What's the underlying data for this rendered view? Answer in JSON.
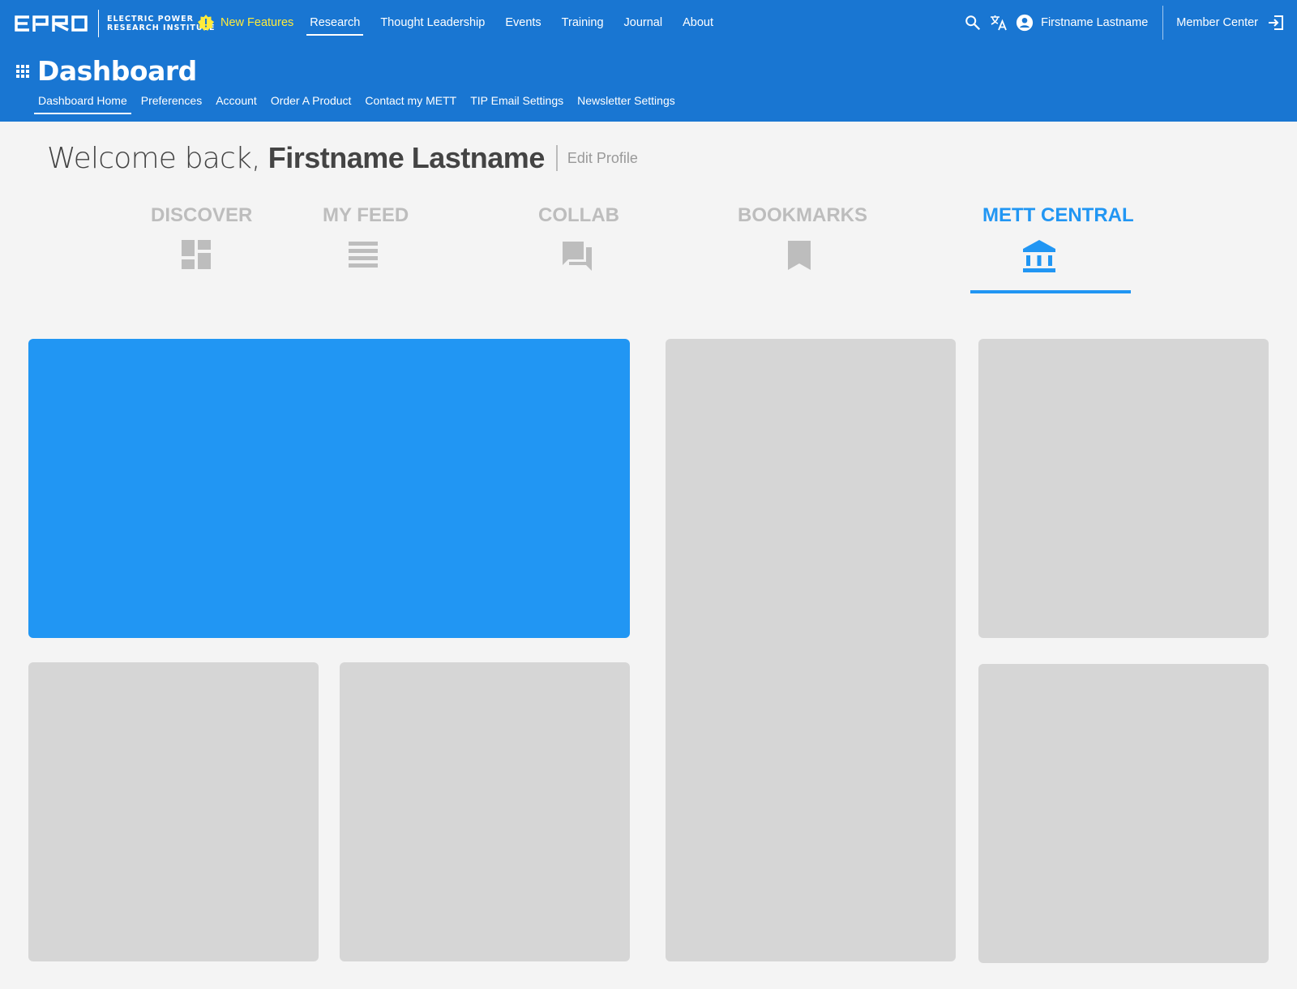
{
  "logo": {
    "line1": "ELECTRIC POWER",
    "line2": "RESEARCH INSTITUTE"
  },
  "top_nav": {
    "new_features": "New Features",
    "items": [
      "Research",
      "Thought Leadership",
      "Events",
      "Training",
      "Journal",
      "About"
    ]
  },
  "user": {
    "name": "Firstname Lastname",
    "member_center": "Member Center"
  },
  "dashboard": {
    "title": "Dashboard",
    "sub_nav": [
      "Dashboard Home",
      "Preferences",
      "Account",
      "Order A Product",
      "Contact my METT",
      "TIP Email Settings",
      "Newsletter Settings"
    ]
  },
  "welcome": {
    "prefix": "Welcome back,",
    "name": "Firstname Lastname",
    "edit_profile": "Edit Profile"
  },
  "tabs": [
    {
      "label": "DISCOVER",
      "icon": "dashboard-icon"
    },
    {
      "label": "MY FEED",
      "icon": "feed-icon"
    },
    {
      "label": "COLLAB",
      "icon": "forum-icon"
    },
    {
      "label": "BOOKMARKS",
      "icon": "bookmark-icon"
    },
    {
      "label": "METT CENTRAL",
      "icon": "bank-icon",
      "active": true
    }
  ],
  "colors": {
    "header": "#1976d2",
    "accent": "#2196f3",
    "new_features": "#ffeb3b",
    "placeholder_card": "#d6d6d6",
    "background": "#f4f4f4"
  }
}
